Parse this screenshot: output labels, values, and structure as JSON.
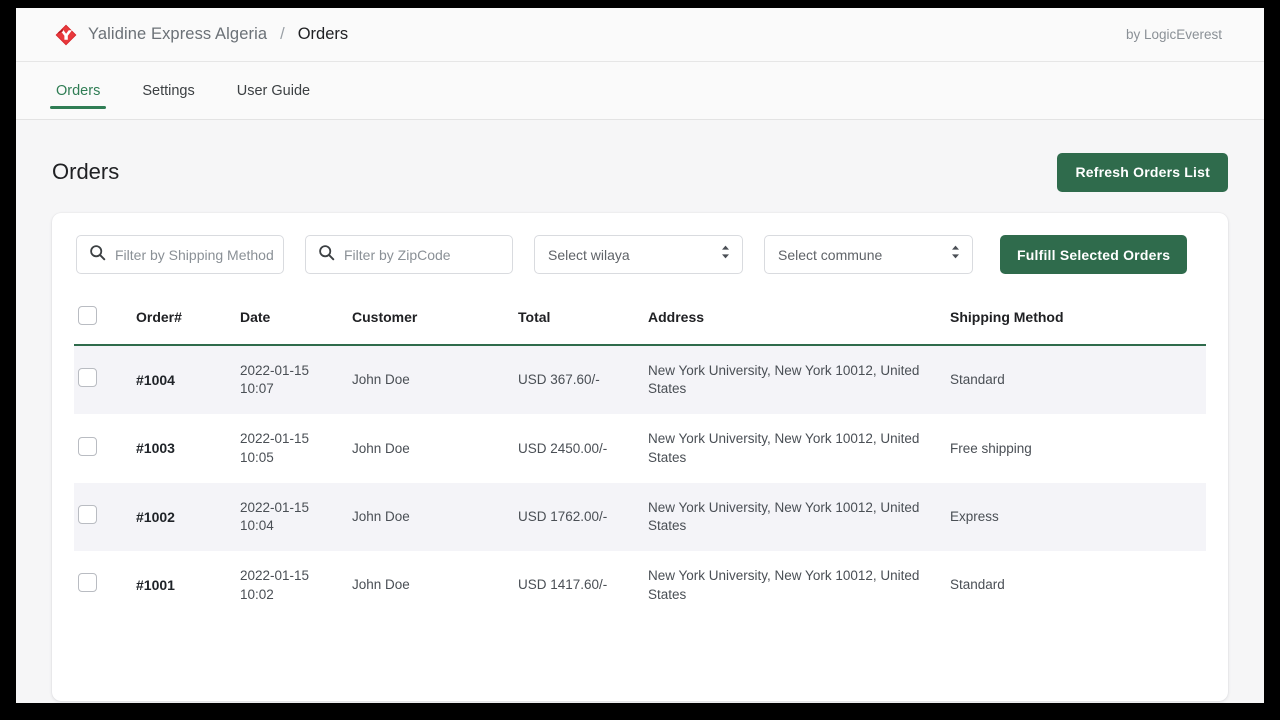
{
  "header": {
    "logo_icon": "yalidine-logo-icon",
    "brand_name": "Yalidine Express Algeria",
    "separator": "/",
    "page_context": "Orders",
    "byline": "by LogicEverest"
  },
  "nav": {
    "tabs": [
      {
        "label": "Orders",
        "active": true
      },
      {
        "label": "Settings",
        "active": false
      },
      {
        "label": "User Guide",
        "active": false
      }
    ]
  },
  "page": {
    "title": "Orders",
    "refresh_button": "Refresh Orders List"
  },
  "filters": {
    "shipping_method": {
      "icon": "search-icon",
      "placeholder": "Filter by Shipping Method",
      "value": ""
    },
    "zipcode": {
      "icon": "search-icon",
      "placeholder": "Filter by ZipCode",
      "value": ""
    },
    "wilaya": {
      "selected": "Select wilaya",
      "icon": "up-down-chevron-icon"
    },
    "commune": {
      "selected": "Select commune",
      "icon": "up-down-chevron-icon"
    },
    "fulfill_button": "Fulfill Selected Orders"
  },
  "table": {
    "columns": {
      "order": "Order#",
      "date": "Date",
      "customer": "Customer",
      "total": "Total",
      "address": "Address",
      "shipping": "Shipping Method"
    },
    "rows": [
      {
        "order": "#1004",
        "date": "2022-01-15 10:07",
        "customer": "John Doe",
        "total": "USD 367.60/-",
        "address": "New York University, New York 10012, United States",
        "shipping": "Standard",
        "striped": true
      },
      {
        "order": "#1003",
        "date": "2022-01-15 10:05",
        "customer": "John Doe",
        "total": "USD 2450.00/-",
        "address": "New York University, New York 10012, United States",
        "shipping": "Free shipping",
        "striped": false
      },
      {
        "order": "#1002",
        "date": "2022-01-15 10:04",
        "customer": "John Doe",
        "total": "USD 1762.00/-",
        "address": "New York University, New York 10012, United States",
        "shipping": "Express",
        "striped": true
      },
      {
        "order": "#1001",
        "date": "2022-01-15 10:02",
        "customer": "John Doe",
        "total": "USD 1417.60/-",
        "address": "New York University, New York 10012, United States",
        "shipping": "Standard",
        "striped": false
      }
    ]
  },
  "colors": {
    "brand_green": "#2f6b4c",
    "accent_green": "#2f7d54",
    "logo_red": "#d6232a",
    "row_stripe": "#f4f4f8",
    "page_bg": "#f6f6f7"
  }
}
